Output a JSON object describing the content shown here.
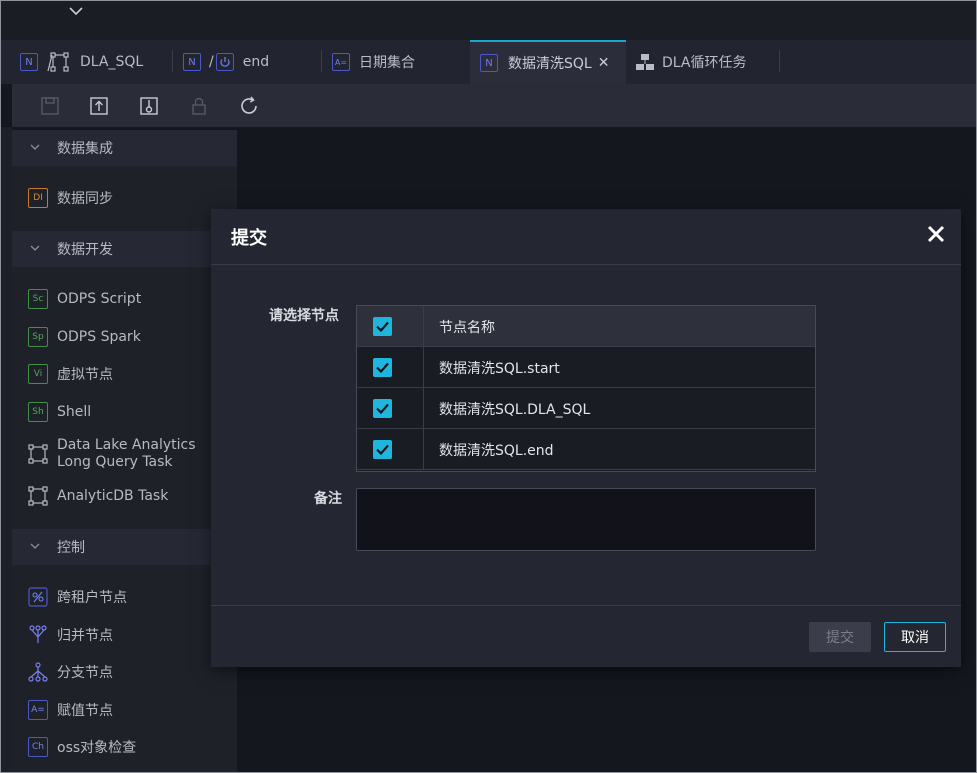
{
  "tabs": [
    {
      "label": "DLA_SQL",
      "prefix": "N"
    },
    {
      "label": "end",
      "prefix": "N"
    },
    {
      "label": "日期集合",
      "prefix": "A="
    },
    {
      "label": "数据清洗SQL",
      "prefix": "N",
      "active": true
    },
    {
      "label": "DLA循环任务"
    }
  ],
  "sidebar": {
    "sections": [
      {
        "label": "数据集成"
      },
      {
        "label": "数据开发"
      },
      {
        "label": "控制"
      }
    ],
    "items": [
      {
        "label": "数据同步",
        "badge": "DI"
      },
      {
        "label": "ODPS Script",
        "badge": "Sc"
      },
      {
        "label": "ODPS Spark",
        "badge": "Sp"
      },
      {
        "label": "虚拟节点",
        "badge": "Vi"
      },
      {
        "label": "Shell",
        "badge": "Sh"
      },
      {
        "label_line1": "Data Lake Analytics",
        "label_line2": "Long Query Task"
      },
      {
        "label": "AnalyticDB Task"
      },
      {
        "label": "跨租户节点"
      },
      {
        "label": "归并节点"
      },
      {
        "label": "分支节点"
      },
      {
        "label": "赋值节点",
        "badge": "A="
      },
      {
        "label": "oss对象检查",
        "badge": "Ch"
      }
    ]
  },
  "modal": {
    "title": "提交",
    "node_label": "请选择节点",
    "table_header": "节点名称",
    "nodes": [
      {
        "name": "数据清洗SQL.start",
        "checked": true
      },
      {
        "name": "数据清洗SQL.DLA_SQL",
        "checked": true
      },
      {
        "name": "数据清洗SQL.end",
        "checked": true
      }
    ],
    "remark_label": "备注",
    "remark_value": "",
    "submit_label": "提交",
    "cancel_label": "取消"
  },
  "colors": {
    "accent": "#1fb6de",
    "background": "#15171f",
    "modal": "#242631"
  }
}
